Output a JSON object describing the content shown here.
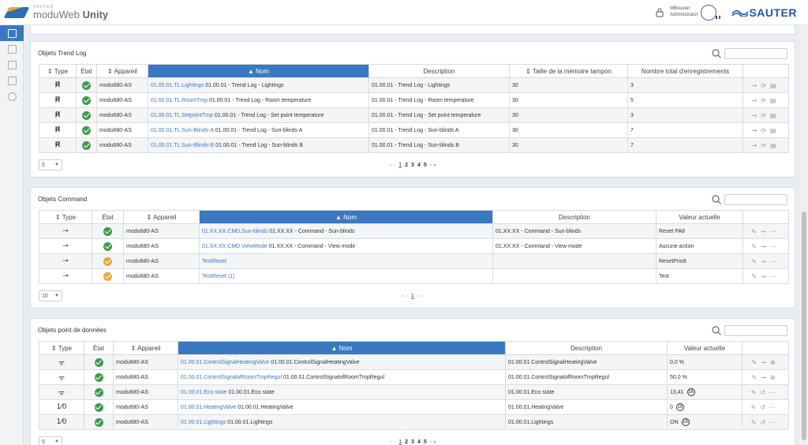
{
  "header": {
    "brand_small": "SAUTER",
    "brand_name": "moduWeb",
    "brand_bold": "Unity",
    "user_name": "MBouvier",
    "user_role": "Administrator",
    "company": "SAUTER"
  },
  "pager": {
    "first": "«",
    "prev": "‹",
    "next": "›",
    "last": "»"
  },
  "trend": {
    "title": "Objets Trend Log",
    "headers": {
      "type": "⇕ Type",
      "etat": "État",
      "appareil": "⇕ Appareil",
      "nom": "▲ Nom",
      "description": "Description",
      "taille": "⇕ Taille de la mémoire tampon",
      "total": "Nombre total d'enregistrements"
    },
    "rows": [
      {
        "type_icon": "trend-log-icon",
        "state": "ok",
        "device": "modu680-AS",
        "address": "01.00.01.TL.Lightings",
        "name": "01.00.01 - Trend Log - Lightings",
        "description": "01.00.01 - Trend Log - Lightings",
        "buffer": "30",
        "total": "3"
      },
      {
        "type_icon": "trend-log-icon",
        "state": "ok",
        "device": "modu680-AS",
        "address": "01.00.01.TL.RoomTmp",
        "name": "01.00.01 - Trend Log - Room temperature",
        "description": "01.00.01 - Trend Log - Room temperature",
        "buffer": "30",
        "total": "5"
      },
      {
        "type_icon": "trend-log-icon",
        "state": "ok",
        "device": "modu680-AS",
        "address": "01.00.01.TL.SetpointTmp",
        "name": "01.00.01 - Trend Log - Set point temperature",
        "description": "01.00.01 - Trend Log - Set point temperature",
        "buffer": "30",
        "total": "3"
      },
      {
        "type_icon": "trend-log-icon",
        "state": "ok",
        "device": "modu680-AS",
        "address": "01.00.01.TL.Sun-Blinds-A",
        "name": "01.00.01 - Trend Log - Sun-blinds A",
        "description": "01.00.01 - Trend Log - Sun-blinds A",
        "buffer": "30",
        "total": "7"
      },
      {
        "type_icon": "trend-log-icon",
        "state": "ok",
        "device": "modu680-AS",
        "address": "01.00.01.TL.Sun-Blinds-B",
        "name": "01.00.01 - Trend Log - Sun-blinds B",
        "description": "01.00.01 - Trend Log - Sun-blinds B",
        "buffer": "30",
        "total": "7"
      }
    ],
    "page_size": "5",
    "pages": [
      "1",
      "2",
      "3",
      "4",
      "5"
    ],
    "current_page": "1"
  },
  "command": {
    "title": "Objets Command",
    "headers": {
      "type": "⇕ Type",
      "etat": "État",
      "appareil": "⇕ Appareil",
      "nom": "▲ Nom",
      "description": "Description",
      "valeur": "Valeur actuelle"
    },
    "rows": [
      {
        "type_icon": "command-icon",
        "state": "ok",
        "device": "modu680-AS",
        "address": "01.XX.XX.CMD.Sun-blinds",
        "name": "01.XX.XX - Command - Sun-blinds",
        "description": "01.XX.XX - Command - Sun-blinds",
        "value": "Reset PA8"
      },
      {
        "type_icon": "command-icon",
        "state": "ok",
        "device": "modu680-AS",
        "address": "01.XX.XX.CMD.ViewMode",
        "name": "01.XX.XX - Command - View mode",
        "description": "01.XX.XX - Command - View mode",
        "value": "Aucune action"
      },
      {
        "type_icon": "command-icon",
        "state": "warn",
        "device": "modu680-AS",
        "address": "TestReset",
        "name": "",
        "description": "",
        "value": "ResetPrio8"
      },
      {
        "type_icon": "command-icon",
        "state": "warn",
        "device": "modu680-AS",
        "address": "TestReset (1)",
        "name": "",
        "description": "",
        "value": "Test"
      }
    ],
    "page_size": "10",
    "pages": [
      "1"
    ],
    "current_page": "1"
  },
  "datapoints": {
    "title": "Objets point de données",
    "headers": {
      "type": "⇕ Type",
      "etat": "État",
      "appareil": "⇕ Appareil",
      "nom": "▲ Nom",
      "description": "Description",
      "valeur": "Valeur actuelle"
    },
    "rows": [
      {
        "type_icon": "analog-output-icon",
        "type_glyph": "ᯤ",
        "state": "ok",
        "device": "modu680-AS",
        "address": "01.00.01.ControlSignalHeatingValve",
        "name": "01.00.01.ControlSignalHeatingValve",
        "description": "01.00.01.ControlSignalHeatingValve",
        "value": "0,0 %",
        "badge": ""
      },
      {
        "type_icon": "analog-output-icon",
        "type_glyph": "ᯤ",
        "state": "ok",
        "device": "modu680-AS",
        "address": "01.00.01.ControlSignalofRoomTmpRegul",
        "name": "01.00.01.ControlSignalofRoomTmpRegul",
        "description": "01.00.01.ControlSignalofRoomTmpRegul",
        "value": "50,0 %",
        "badge": ""
      },
      {
        "type_icon": "analog-output-icon",
        "type_glyph": "ᯤ",
        "state": "ok",
        "device": "modu680-AS",
        "address": "01.00.01.Eco state",
        "name": "01.00.01.Eco state",
        "description": "01.00.01.Eco state",
        "value": "13,41",
        "badge": "16"
      },
      {
        "type_icon": "binary-output-icon",
        "type_glyph": "1⁄0",
        "state": "ok",
        "device": "modu680-AS",
        "address": "01.00.01.HeatingValve",
        "name": "01.00.01.HeatingValve",
        "description": "01.00.01.HeatingValve",
        "value": "0",
        "badge": "16"
      },
      {
        "type_icon": "binary-output-icon",
        "type_glyph": "1⁄0",
        "state": "ok",
        "device": "modu680-AS",
        "address": "01.00.01.Lightings",
        "name": "01.00.01.Lightings",
        "description": "01.00.01.Lightings",
        "value": "ON",
        "badge": "16"
      }
    ],
    "page_size": "5",
    "pages": [
      "1",
      "2",
      "3",
      "4",
      "5"
    ],
    "current_page": "1"
  }
}
